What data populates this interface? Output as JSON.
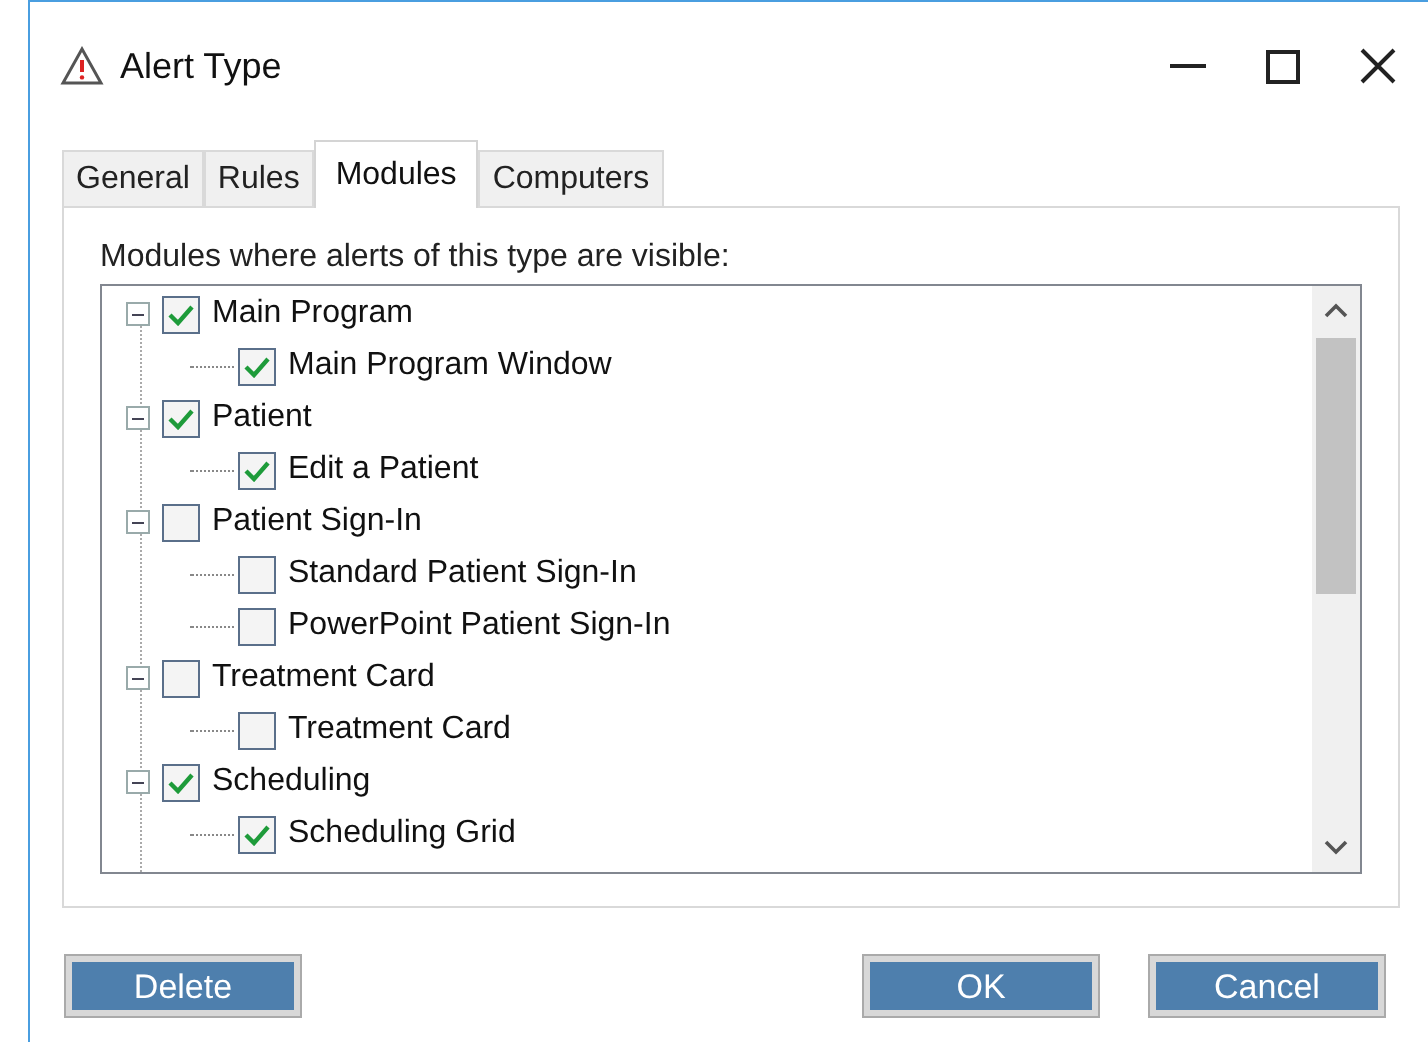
{
  "window": {
    "title": "Alert Type"
  },
  "tabs": [
    {
      "label": "General",
      "selected": false
    },
    {
      "label": "Rules",
      "selected": false
    },
    {
      "label": "Modules",
      "selected": true
    },
    {
      "label": "Computers",
      "selected": false
    }
  ],
  "caption": "Modules where alerts of this type are visible:",
  "tree": [
    {
      "label": "Main Program",
      "checked": true,
      "expanded": true,
      "children": [
        {
          "label": "Main Program Window",
          "checked": true
        }
      ]
    },
    {
      "label": "Patient",
      "checked": true,
      "expanded": true,
      "children": [
        {
          "label": "Edit a Patient",
          "checked": true
        }
      ]
    },
    {
      "label": "Patient Sign-In",
      "checked": false,
      "expanded": true,
      "children": [
        {
          "label": "Standard Patient Sign-In",
          "checked": false
        },
        {
          "label": "PowerPoint Patient Sign-In",
          "checked": false
        }
      ]
    },
    {
      "label": "Treatment Card",
      "checked": false,
      "expanded": true,
      "children": [
        {
          "label": "Treatment Card",
          "checked": false
        }
      ]
    },
    {
      "label": "Scheduling",
      "checked": true,
      "expanded": true,
      "children": [
        {
          "label": "Scheduling Grid",
          "checked": true
        }
      ]
    }
  ],
  "buttons": [
    {
      "label": "Delete",
      "kind": "left"
    },
    {
      "label": "OK",
      "kind": "right"
    },
    {
      "label": "Cancel",
      "kind": "right"
    }
  ]
}
